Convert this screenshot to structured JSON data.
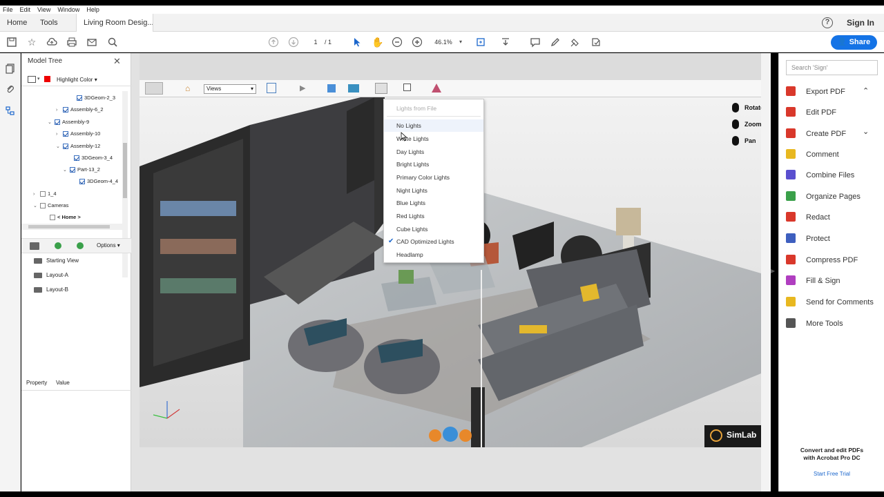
{
  "menu": [
    "File",
    "Edit",
    "View",
    "Window",
    "Help"
  ],
  "tabs": {
    "home": "Home",
    "tools": "Tools",
    "document": "Living Room Desig..."
  },
  "header": {
    "sign_in": "Sign In",
    "share": "Share",
    "help_icon": "question-circle-icon"
  },
  "toolbar": {
    "page_current": "1",
    "page_total": "/ 1",
    "zoom": "46.1%"
  },
  "model_tree": {
    "title": "Model Tree",
    "highlight_color_label": "Highlight Color",
    "highlight_color": "#e00000",
    "nodes": [
      {
        "label": "3DGeom-2_3",
        "checked": true
      },
      {
        "label": "Assembly-6_2",
        "checked": true
      },
      {
        "label": "Assembly-9",
        "checked": true
      },
      {
        "label": "Assembly-10",
        "checked": true
      },
      {
        "label": "Assembly-12",
        "checked": true
      },
      {
        "label": "3DGeom-3_4",
        "checked": true
      },
      {
        "label": "Part-13_2",
        "checked": true
      },
      {
        "label": "3DGeom-4_4",
        "checked": true
      },
      {
        "label": "1_4",
        "checked": false
      },
      {
        "label": "Cameras",
        "checked": false
      },
      {
        "label": "< Home >",
        "checked": false
      }
    ],
    "views_options_label": "Options",
    "views": [
      "Starting View",
      "Layout-A",
      "Layout-B"
    ],
    "property_headers": [
      "Property",
      "Value"
    ]
  },
  "scene": {
    "views_select": "Views",
    "controls": [
      "Rotate",
      "Zoom",
      "Pan"
    ],
    "brand": "SimLab",
    "lighting_menu": {
      "header": "Lights from File",
      "items": [
        {
          "label": "No Lights",
          "checked": false,
          "hover": true
        },
        {
          "label": "White Lights",
          "checked": false
        },
        {
          "label": "Day Lights",
          "checked": false
        },
        {
          "label": "Bright Lights",
          "checked": false
        },
        {
          "label": "Primary Color Lights",
          "checked": false
        },
        {
          "label": "Night Lights",
          "checked": false
        },
        {
          "label": "Blue Lights",
          "checked": false
        },
        {
          "label": "Red Lights",
          "checked": false
        },
        {
          "label": "Cube Lights",
          "checked": false
        },
        {
          "label": "CAD Optimized Lights",
          "checked": true
        },
        {
          "label": "Headlamp",
          "checked": false
        }
      ]
    }
  },
  "right_panel": {
    "search_placeholder": "Search 'Sign'",
    "tools": [
      {
        "label": "Export PDF",
        "icon": "export-pdf-icon",
        "color": "#d9382b",
        "chevron": "up"
      },
      {
        "label": "Edit PDF",
        "icon": "edit-pdf-icon",
        "color": "#d9382b"
      },
      {
        "label": "Create PDF",
        "icon": "create-pdf-icon",
        "color": "#d9382b",
        "chevron": "down"
      },
      {
        "label": "Comment",
        "icon": "comment-icon",
        "color": "#e8b820"
      },
      {
        "label": "Combine Files",
        "icon": "combine-files-icon",
        "color": "#5a4fcf"
      },
      {
        "label": "Organize Pages",
        "icon": "organize-pages-icon",
        "color": "#3aa04a"
      },
      {
        "label": "Redact",
        "icon": "redact-icon",
        "color": "#d9382b"
      },
      {
        "label": "Protect",
        "icon": "protect-icon",
        "color": "#3e5fbf"
      },
      {
        "label": "Compress PDF",
        "icon": "compress-pdf-icon",
        "color": "#d9382b"
      },
      {
        "label": "Fill & Sign",
        "icon": "fill-sign-icon",
        "color": "#b03ec0"
      },
      {
        "label": "Send for Comments",
        "icon": "send-for-comments-icon",
        "color": "#e8b820"
      },
      {
        "label": "More Tools",
        "icon": "more-tools-icon",
        "color": "#555555"
      }
    ],
    "promo_line1": "Convert and edit PDFs",
    "promo_line2": "with Acrobat Pro DC",
    "trial_link": "Start Free Trial"
  }
}
